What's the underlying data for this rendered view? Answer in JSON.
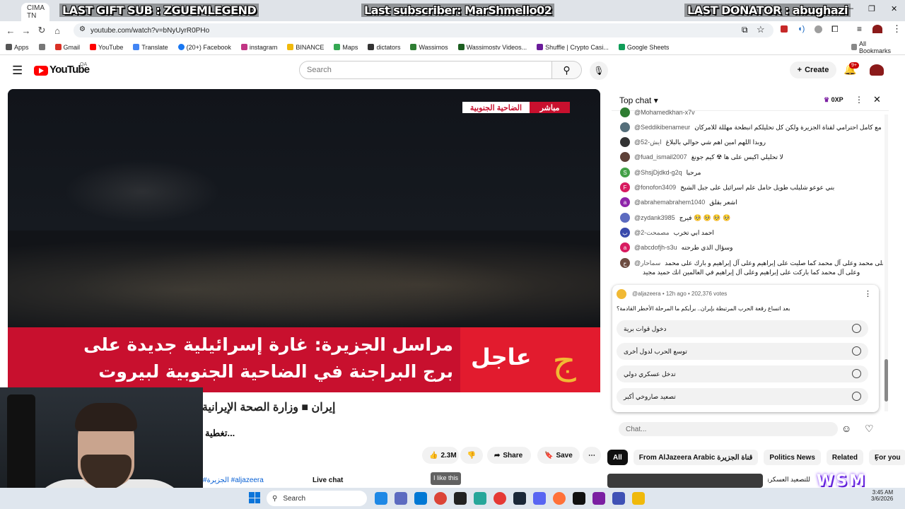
{
  "browser": {
    "tab_title": "CIMA TN",
    "url": "youtube.com/watch?v=bNyUyrR0PHo",
    "bookmarks": [
      "Apps",
      "Gmail",
      "YouTube",
      "Translate",
      "(20+) Facebook",
      "instagram",
      "BINANCE",
      "Maps",
      "dictators",
      "Wassimos",
      "Wassimostv Videos...",
      "Shuffle | Crypto Casi...",
      "Google Sheets"
    ],
    "all_bookmarks": "All Bookmarks"
  },
  "overlay": {
    "gift": "LAST GIFT SUB : ZGUEMLEGEND",
    "subscriber": "Last subscriber: MarShmello02",
    "donator": "LAST DONATOR : abughazi",
    "logo": "WSM"
  },
  "youtube": {
    "logo": "YouTube",
    "region": "QA",
    "search_placeholder": "Search",
    "create": "Create",
    "notif_count": "9+"
  },
  "video": {
    "location_tag": "الضاحية الجنوبية",
    "live_tag": "مباشر",
    "headline_line1": "مراسل الجزيرة: غارة إسرائيلية جديدة على",
    "headline_line2": "برج البراجنة في الضاحية الجنوبية لبيروت",
    "urgent": "عاجل",
    "ticker": "إيران ■ وزارة الصحة الإيرانية: مقتل 4 وإصابة 28 من العاملين في القطا",
    "title": "تغطية...",
    "likes": "2.3M",
    "share": "Share",
    "save": "Save",
    "tooltip": "I like this",
    "hashtags": "#الجزيرة #aljazeera",
    "live_chat": "Live chat"
  },
  "chat": {
    "mode": "Top chat",
    "points": "0XP",
    "messages": [
      {
        "user": "@Mohamedkhan-x7v",
        "text": "",
        "color": "#2e7d32",
        "initial": ""
      },
      {
        "user": "@Seddikibenameur",
        "text": "مع كامل احترامي لقناة الجزيرة ولكن كل تحليلكم انبطحة مهللة للامركان",
        "color": "#546e7a",
        "initial": ""
      },
      {
        "user": "@ايش-52",
        "text": "روبدا اللهم امين اهم شي حوالي بالبلاغ",
        "color": "#333333",
        "initial": ""
      },
      {
        "user": "@fuad_ismail2007",
        "text": "لا تحليلي اكيس على ها ☢ كيم جونغ",
        "color": "#5d4037",
        "initial": ""
      },
      {
        "user": "@ShsjDjdkd-g2q",
        "text": "مرحبا",
        "color": "#43a047",
        "initial": "S"
      },
      {
        "user": "@fonofon3409",
        "text": "بني عوعو شليلب طويل حامل علم اسرائيل على جبل الشيخ",
        "color": "#d81b60",
        "initial": "F"
      },
      {
        "user": "@abrahemabrahem1040",
        "text": "اشعر بقلق",
        "color": "#8e24aa",
        "initial": "a"
      },
      {
        "user": "@zydank3985",
        "text": "فيرج 🥺 🥺 🥺 🥺",
        "color": "#5c6bc0",
        "initial": ""
      },
      {
        "user": "@مصمحت-2",
        "text": "احمد ابي تخرب",
        "color": "#3949ab",
        "initial": "ب"
      },
      {
        "user": "@abcdofjh-s3u",
        "text": "وسؤال الذي طرحته",
        "color": "#d81b60",
        "initial": "a"
      },
      {
        "user": "@سماحار",
        "text": "اللهم صل على محمد وعلى آل محمد كما صليت على إبراهيم وعلى آل إبراهيم و بارك على محمد",
        "color": "#6d4c41",
        "initial": "ح"
      },
      {
        "user": "",
        "text": "وعلى آل محمد كما باركت على إبراهيم وعلى آل إبراهيم في العالمين انك حميد مجيد",
        "color": "",
        "initial": ""
      }
    ],
    "poll": {
      "author": "@aljazeera",
      "meta": "12h ago • 202,376 votes",
      "question": "بعد اتساع رقعة الحرب المرتبطة بإيران.. برأيكم ما المرحلة الأخطر القادمة؟",
      "options": [
        "دخول قوات برية",
        "توسع الحرب لدول أخرى",
        "تدخل عسكري دولي",
        "تصعيد صاروخي أكبر"
      ]
    },
    "input_placeholder": "Chat..."
  },
  "chips": [
    "All",
    "From AlJazeera Arabic قناة الجزيرة",
    "Politics News",
    "Related",
    "For you"
  ],
  "related_snippet": "للتصعيد العسكري بين",
  "taskbar": {
    "search": "Search",
    "time": "3:45 AM",
    "date": "3/6/2026"
  }
}
